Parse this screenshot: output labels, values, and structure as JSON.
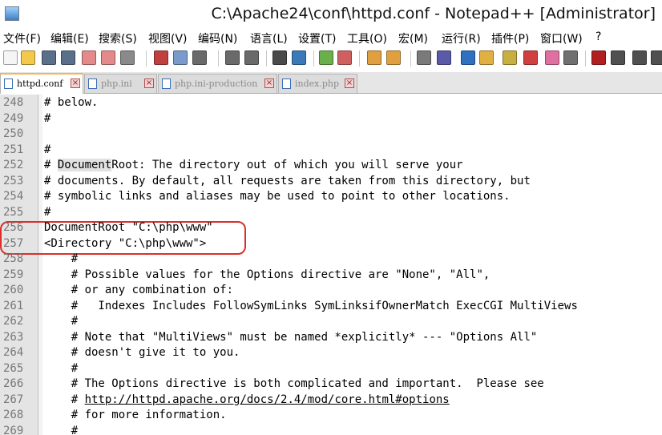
{
  "window": {
    "title": "C:\\Apache24\\conf\\httpd.conf - Notepad++ [Administrator]"
  },
  "menu": [
    "文件(F)",
    "编辑(E)",
    "搜索(S)",
    "视图(V)",
    "编码(N)",
    "语言(L)",
    "设置(T)",
    "工具(O)",
    "宏(M)",
    "运行(R)",
    "插件(P)",
    "窗口(W)",
    "?"
  ],
  "toolbar": {
    "buttons": [
      "new-file-icon",
      "open-file-icon",
      "save-icon",
      "save-all-icon",
      "close-icon",
      "close-all-icon",
      "print-icon",
      "cut-icon",
      "copy-icon",
      "paste-icon",
      "undo-icon",
      "redo-icon",
      "find-icon",
      "replace-icon",
      "zoom-in-icon",
      "zoom-out-icon",
      "sync-vertical-icon",
      "sync-horizontal-icon",
      "word-wrap-icon",
      "show-all-chars-icon",
      "indent-guide-icon",
      "doc-map-icon",
      "function-list-icon",
      "folder-workspace-icon",
      "monitor-icon",
      "eye-icon",
      "record-macro-icon",
      "stop-record-icon",
      "play-macro-icon",
      "run-macro-multiple-icon"
    ]
  },
  "tabs": [
    {
      "label": "httpd.conf",
      "active": true
    },
    {
      "label": "php.ini",
      "active": false
    },
    {
      "label": "php.ini-production",
      "active": false
    },
    {
      "label": "index.php",
      "active": false
    }
  ],
  "editor": {
    "lines": [
      {
        "num": "248",
        "text": "# below."
      },
      {
        "num": "249",
        "text": "#"
      },
      {
        "num": "250",
        "text": ""
      },
      {
        "num": "251",
        "text": "#"
      },
      {
        "num": "252",
        "pre": "# ",
        "hl": "Document",
        "post": "Root: The directory out of which you will serve your"
      },
      {
        "num": "253",
        "text": "# documents. By default, all requests are taken from this directory, but"
      },
      {
        "num": "254",
        "text": "# symbolic links and aliases may be used to point to other locations."
      },
      {
        "num": "255",
        "text": "#"
      },
      {
        "num": "256",
        "text": "DocumentRoot \"C:\\php\\www\""
      },
      {
        "num": "257",
        "text": "<Directory \"C:\\php\\www\">"
      },
      {
        "num": "258",
        "text": "    #"
      },
      {
        "num": "259",
        "text": "    # Possible values for the Options directive are \"None\", \"All\","
      },
      {
        "num": "260",
        "text": "    # or any combination of:"
      },
      {
        "num": "261",
        "text": "    #   Indexes Includes FollowSymLinks SymLinksifOwnerMatch ExecCGI MultiViews"
      },
      {
        "num": "262",
        "text": "    #"
      },
      {
        "num": "263",
        "text": "    # Note that \"MultiViews\" must be named *explicitly* --- \"Options All\""
      },
      {
        "num": "264",
        "text": "    # doesn't give it to you."
      },
      {
        "num": "265",
        "text": "    #"
      },
      {
        "num": "266",
        "text": "    # The Options directive is both complicated and important.  Please see"
      },
      {
        "num": "267",
        "pre": "    # ",
        "link": "http://httpd.apache.org/docs/2.4/mod/core.html#options"
      },
      {
        "num": "268",
        "text": "    # for more information."
      },
      {
        "num": "269",
        "text": "    #"
      }
    ]
  },
  "colors": {
    "annotation_box": "#d9302c",
    "active_tab_accent": "#fab44b",
    "gutter_bg": "#e4e4e4"
  }
}
